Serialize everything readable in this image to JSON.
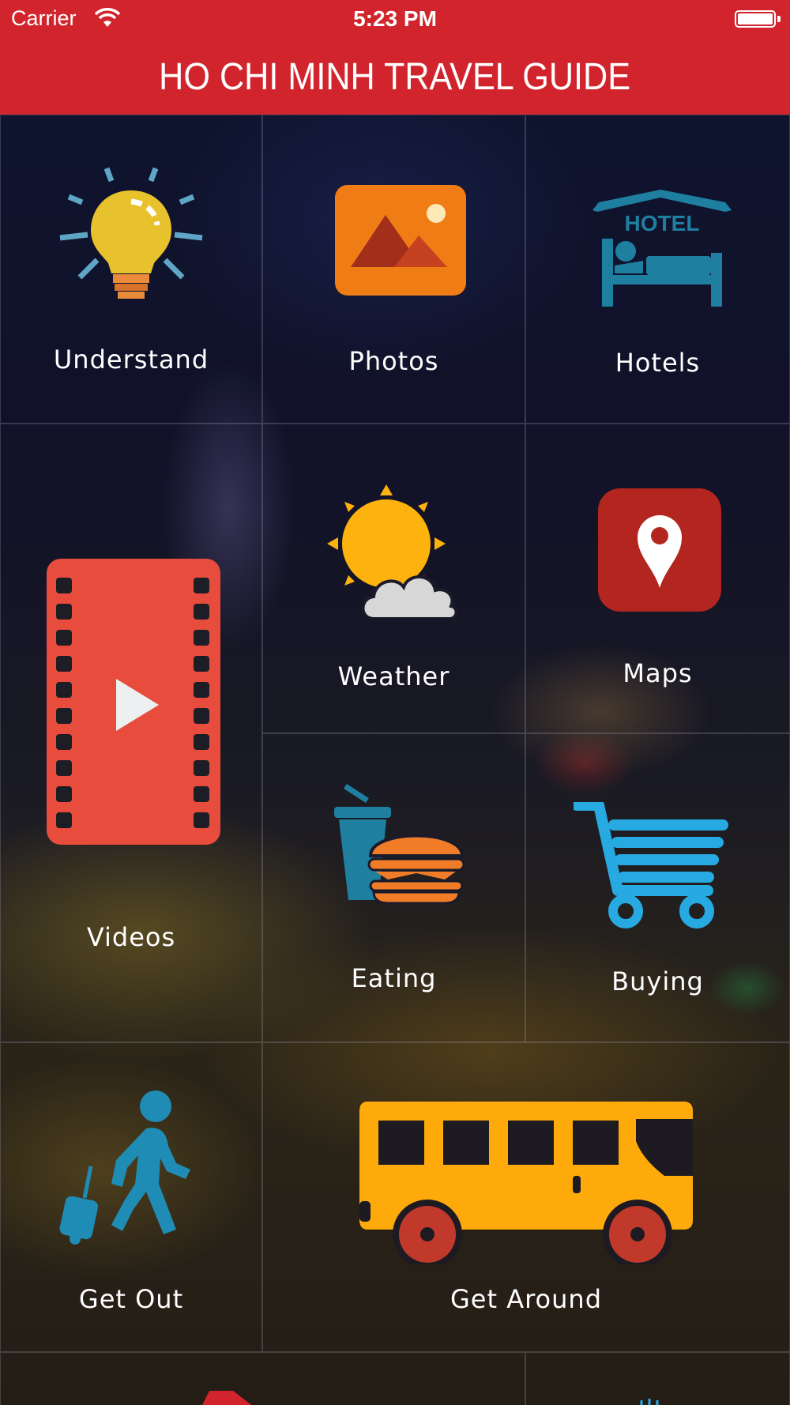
{
  "status_bar": {
    "carrier": "Carrier",
    "time": "5:23 PM"
  },
  "nav": {
    "title": "HO CHI MINH TRAVEL GUIDE"
  },
  "colors": {
    "brand_red": "#d1242c",
    "bulb_yellow": "#e8c22c",
    "bulb_base": "#e98b3a",
    "ray_blue": "#5fa6c6",
    "photo_orange": "#f07c16",
    "hotel_teal": "#1f7fa1",
    "weather_sun": "#fdb20d",
    "maps_red": "#b3261f",
    "video_red": "#e84c3d",
    "burger_orange": "#f07c28",
    "cart_blue": "#27a9e1",
    "bus_yellow": "#fdaa0a",
    "wheel_red": "#c0392b",
    "walker_blue": "#1f8cb5"
  },
  "tiles": {
    "understand": {
      "label": "Understand",
      "icon": "lightbulb-icon"
    },
    "photos": {
      "label": "Photos",
      "icon": "photo-icon"
    },
    "hotels": {
      "label": "Hotels",
      "icon": "hotel-icon",
      "icon_text": "HOTEL"
    },
    "videos": {
      "label": "Videos",
      "icon": "film-play-icon"
    },
    "weather": {
      "label": "Weather",
      "icon": "sun-cloud-icon"
    },
    "maps": {
      "label": "Maps",
      "icon": "map-pin-icon"
    },
    "eating": {
      "label": "Eating",
      "icon": "burger-drink-icon"
    },
    "buying": {
      "label": "Buying",
      "icon": "shopping-cart-icon"
    },
    "get_out": {
      "label": "Get Out",
      "icon": "traveler-icon"
    },
    "get_around": {
      "label": "Get Around",
      "icon": "bus-icon"
    }
  }
}
